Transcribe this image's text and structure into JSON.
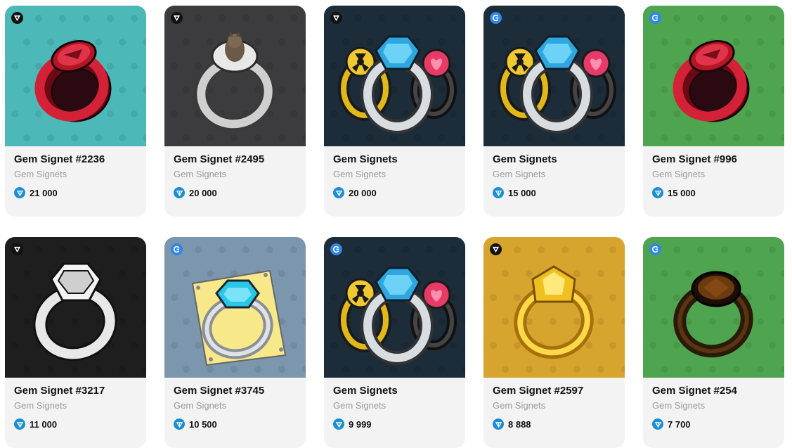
{
  "cards": [
    {
      "title": "Gem Signet #2236",
      "collection": "Gem Signets",
      "price": "21 000",
      "badge": "market-icon",
      "bg": "#4cb8b8",
      "ring": "red"
    },
    {
      "title": "Gem Signet #2495",
      "collection": "Gem Signets",
      "price": "20 000",
      "badge": "market-icon",
      "bg": "#3c3c3e",
      "ring": "cat"
    },
    {
      "title": "Gem Signets",
      "collection": "Gem Signets",
      "price": "20 000",
      "badge": "market-icon",
      "bg": "#1c2c38",
      "ring": "trio"
    },
    {
      "title": "Gem Signets",
      "collection": "Gem Signets",
      "price": "15 000",
      "badge": "getgems-icon",
      "bg": "#1c2c38",
      "ring": "trio"
    },
    {
      "title": "Gem Signet #996",
      "collection": "Gem Signets",
      "price": "15 000",
      "badge": "getgems-icon",
      "bg": "#4fa54f",
      "ring": "red"
    },
    {
      "title": "Gem Signet #3217",
      "collection": "Gem Signets",
      "price": "11 000",
      "badge": "market-icon",
      "bg": "#1e1e1e",
      "ring": "white"
    },
    {
      "title": "Gem Signet #3745",
      "collection": "Gem Signets",
      "price": "10 500",
      "badge": "getgems-icon",
      "bg": "#7b96ad",
      "ring": "paper"
    },
    {
      "title": "Gem Signets",
      "collection": "Gem Signets",
      "price": "9 999",
      "badge": "getgems-icon",
      "bg": "#1c2c38",
      "ring": "trio"
    },
    {
      "title": "Gem Signet #2597",
      "collection": "Gem Signets",
      "price": "8 888",
      "badge": "market-icon",
      "bg": "#d7a42e",
      "ring": "gold"
    },
    {
      "title": "Gem Signet #254",
      "collection": "Gem Signets",
      "price": "7 700",
      "badge": "getgems-icon",
      "bg": "#4fa54f",
      "ring": "dark"
    }
  ],
  "currency_icon": "ton-icon",
  "colors": {
    "card_bg": "#f3f3f3",
    "ton_blue": "#1a8fd6",
    "getgems_blue": "#2f86ea",
    "muted_text": "#9a9a9a"
  }
}
